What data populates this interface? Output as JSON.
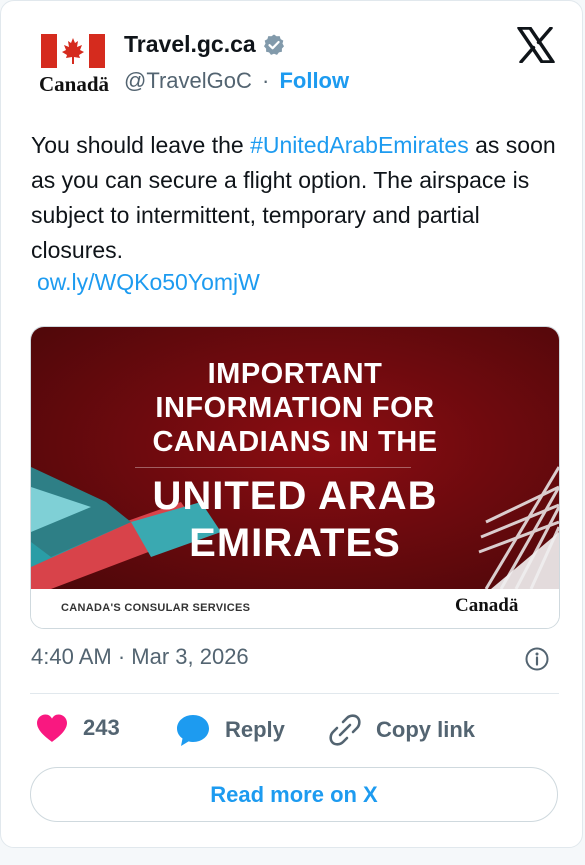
{
  "account": {
    "display_name": "Travel.gc.ca",
    "handle": "@TravelGoC",
    "separator": "·",
    "follow_label": "Follow",
    "logo_wordmark": "Canadä",
    "verified_icon": "verified-badge-icon",
    "platform_icon": "x-logo-icon"
  },
  "tweet": {
    "text_before": "You should leave the ",
    "hashtag": "#UnitedArabEmirates",
    "text_after": " as soon as you can secure a flight option. The airspace is subject to intermittent, temporary and partial closures.",
    "link": "ow.ly/WQKo50YomjW"
  },
  "media": {
    "line1": "IMPORTANT",
    "line2": "INFORMATION FOR",
    "line3": "CANADIANS IN THE",
    "big1": "UNITED ARAB",
    "big2": "EMIRATES",
    "footer_left": "CANADA'S CONSULAR SERVICES",
    "footer_right": "Canadä"
  },
  "meta": {
    "timestamp": "4:40 AM · Mar 3, 2026",
    "info_icon": "info-icon"
  },
  "actions": {
    "like_count": "243",
    "reply_label": "Reply",
    "copy_label": "Copy link",
    "read_more_label": "Read more on X"
  },
  "colors": {
    "accent": "#1d9bf0",
    "like": "#f91880",
    "flag_red": "#d52b1e",
    "media_red": "#6d0a0e"
  }
}
